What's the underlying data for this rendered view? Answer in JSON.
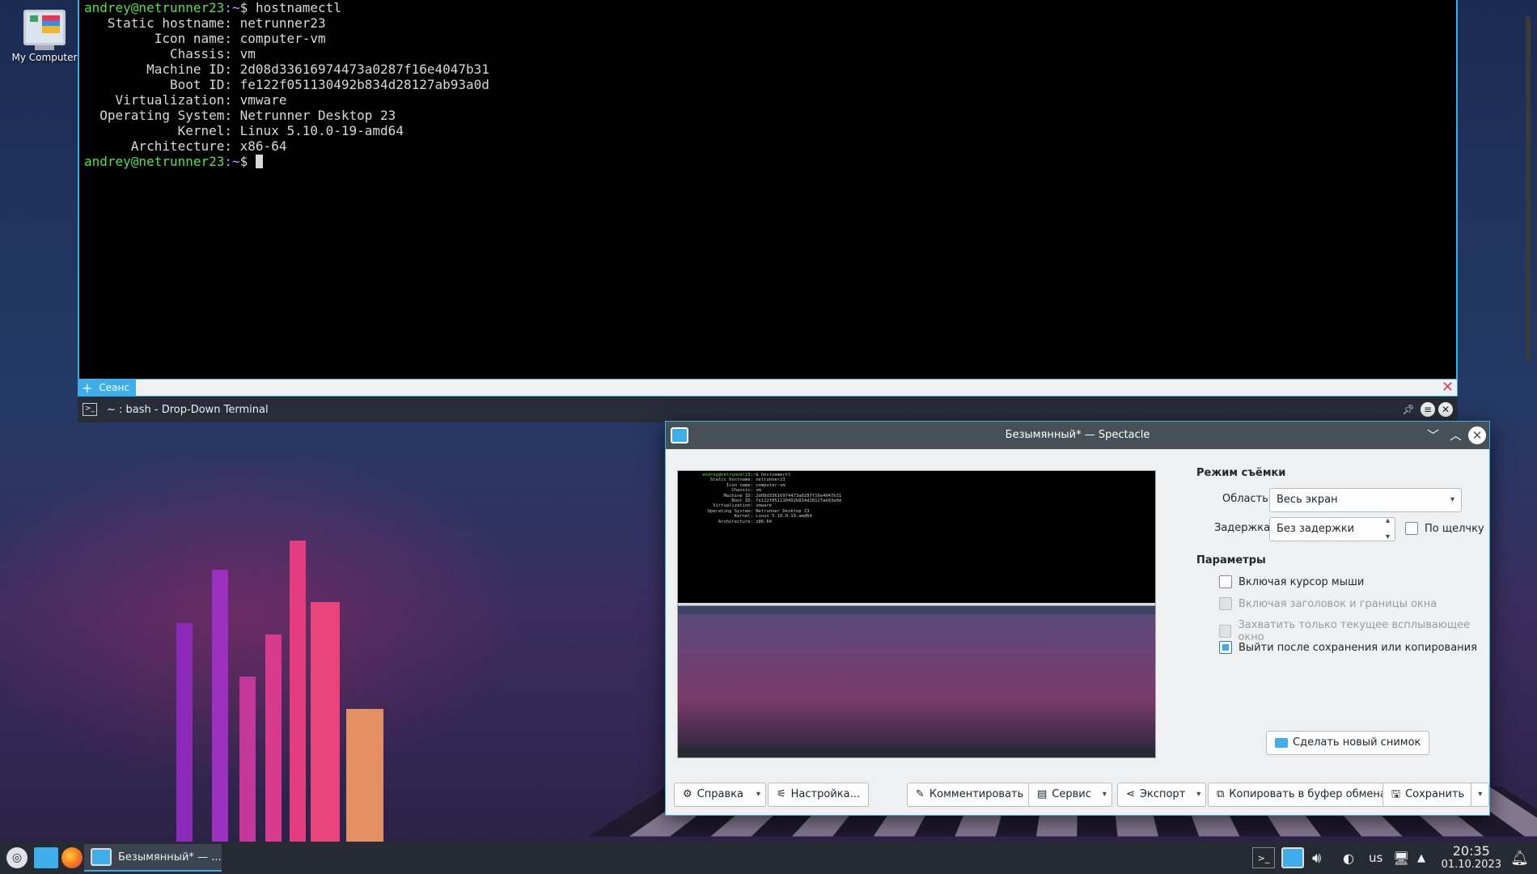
{
  "desktop": {
    "icon_label": "My Computer"
  },
  "terminal": {
    "prompt_user": "andrey@netrunner23",
    "prompt_path": ":~",
    "prompt_symbol": "$",
    "command": "hostnamectl",
    "output": [
      "   Static hostname: netrunner23",
      "         Icon name: computer-vm",
      "           Chassis: vm",
      "        Machine ID: 2d08d33616974473a0287f16e4047b31",
      "           Boot ID: fe122f051130492b834d28127ab93a0d",
      "    Virtualization: vmware",
      "  Operating System: Netrunner Desktop 23",
      "            Kernel: Linux 5.10.0-19-amd64",
      "      Architecture: x86-64"
    ],
    "tab_add": "+",
    "tab_label": "Сеанс",
    "title": "~ : bash - Drop-Down Terminal"
  },
  "spectacle": {
    "title": "Безымянный* — Spectacle",
    "capture_mode_heading": "Режим съёмки",
    "area_label": "Область:",
    "area_value": "Весь экран",
    "delay_label": "Задержка:",
    "delay_value": "Без задержки",
    "on_click_label": "По щелчку",
    "params_heading": "Параметры",
    "options": [
      {
        "label": "Включая курсор мыши",
        "checked": false,
        "disabled": false
      },
      {
        "label": "Включая заголовок и границы окна",
        "checked": false,
        "disabled": true
      },
      {
        "label": "Захватить только текущее всплывающее окно",
        "checked": false,
        "disabled": true
      },
      {
        "label": "Выйти после сохранения или копирования",
        "checked": true,
        "disabled": false
      }
    ],
    "new_shot": "Сделать новый снимок",
    "buttons": {
      "help": "Справка",
      "settings": "Настройка...",
      "annotate": "Комментировать",
      "service": "Сервис",
      "export": "Экспорт",
      "copy": "Копировать в буфер обмена",
      "save": "Сохранить"
    }
  },
  "taskbar": {
    "task_title": "Безымянный* — ...",
    "layout": "us",
    "time": "20:35",
    "date": "01.10.2023"
  },
  "colors": {
    "accent": "#3daee9",
    "prompt": "#54e04a",
    "path": "#9ab4ff",
    "close": "#da4453"
  }
}
